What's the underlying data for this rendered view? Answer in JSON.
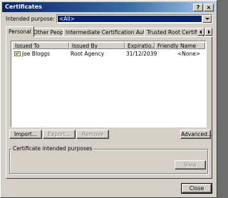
{
  "window": {
    "title": "Certificates"
  },
  "purpose": {
    "label": "Intended purpose:",
    "value": "<All>"
  },
  "tabs": [
    {
      "label": "Personal",
      "active": true
    },
    {
      "label": "Other People"
    },
    {
      "label": "Intermediate Certification Authorities"
    },
    {
      "label": "Trusted Root Certification"
    }
  ],
  "list": {
    "columns": [
      "Issued To",
      "Issued By",
      "Expiratio...",
      "Friendly Name"
    ],
    "rows": [
      {
        "issued_to": "Joe Bloggs",
        "issued_by": "Root Agency",
        "expiration": "31/12/2039",
        "friendly_name": "<None>"
      }
    ]
  },
  "buttons": {
    "import": "Import...",
    "export": "Export...",
    "remove": "Remove",
    "advanced": "Advanced...",
    "view": "View",
    "close": "Close"
  },
  "purposes_group": {
    "title": "Certificate intended purposes"
  },
  "colors": {
    "title_start": "#0a246a",
    "title_end": "#a6caf0",
    "face": "#d4d0c8",
    "selection": "#0a246a"
  },
  "icons": [
    "help-icon",
    "close-icon",
    "chevron-down-icon",
    "arrow-left-icon",
    "arrow-right-icon",
    "certificate-icon"
  ]
}
